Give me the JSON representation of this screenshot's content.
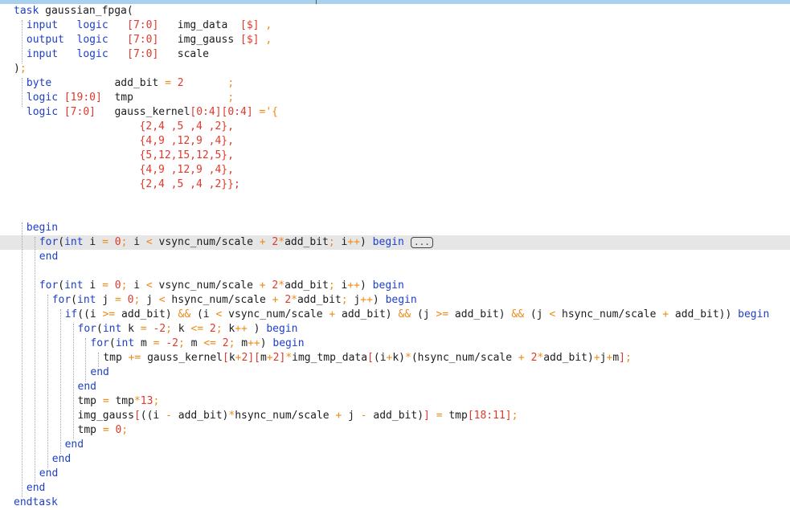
{
  "editor": {
    "fold_marker": "...",
    "lines": [
      {
        "i": 0,
        "segs": [
          [
            "kw",
            "task"
          ],
          [
            "p",
            " gaussian_fpga("
          ]
        ]
      },
      {
        "i": 2,
        "segs": [
          [
            "kw",
            "input"
          ],
          [
            "p",
            "   "
          ],
          [
            "kw",
            "logic"
          ],
          [
            "p",
            "   "
          ],
          [
            "num",
            "[7:0]"
          ],
          [
            "p",
            "   img_data  "
          ],
          [
            "num",
            "[$]"
          ],
          [
            "p",
            " "
          ],
          [
            "op",
            ","
          ]
        ]
      },
      {
        "i": 2,
        "segs": [
          [
            "kw",
            "output"
          ],
          [
            "p",
            "  "
          ],
          [
            "kw",
            "logic"
          ],
          [
            "p",
            "   "
          ],
          [
            "num",
            "[7:0]"
          ],
          [
            "p",
            "   img_gauss "
          ],
          [
            "num",
            "[$]"
          ],
          [
            "p",
            " "
          ],
          [
            "op",
            ","
          ]
        ]
      },
      {
        "i": 2,
        "segs": [
          [
            "kw",
            "input"
          ],
          [
            "p",
            "   "
          ],
          [
            "kw",
            "logic"
          ],
          [
            "p",
            "   "
          ],
          [
            "num",
            "[7:0]"
          ],
          [
            "p",
            "   scale"
          ]
        ]
      },
      {
        "i": 0,
        "segs": [
          [
            "p",
            ")"
          ],
          [
            "op",
            ";"
          ]
        ]
      },
      {
        "i": 2,
        "segs": [
          [
            "kw",
            "byte"
          ],
          [
            "p",
            "          add_bit "
          ],
          [
            "op",
            "="
          ],
          [
            "p",
            " "
          ],
          [
            "num",
            "2"
          ],
          [
            "p",
            "       "
          ],
          [
            "op",
            ";"
          ]
        ]
      },
      {
        "i": 2,
        "segs": [
          [
            "kw",
            "logic"
          ],
          [
            "p",
            " "
          ],
          [
            "num",
            "[19:0]"
          ],
          [
            "p",
            "  tmp               "
          ],
          [
            "op",
            ";"
          ]
        ]
      },
      {
        "i": 2,
        "segs": [
          [
            "kw",
            "logic"
          ],
          [
            "p",
            " "
          ],
          [
            "num",
            "[7:0]"
          ],
          [
            "p",
            "   gauss_kernel"
          ],
          [
            "num",
            "[0:4][0:4]"
          ],
          [
            "p",
            " "
          ],
          [
            "op",
            "='{"
          ]
        ]
      },
      {
        "i": 0,
        "segs": [
          [
            "p",
            "                    "
          ],
          [
            "num",
            "{2,4 ,5 ,4 ,2},"
          ]
        ]
      },
      {
        "i": 0,
        "segs": [
          [
            "p",
            "                    "
          ],
          [
            "num",
            "{4,9 ,12,9 ,4},"
          ]
        ]
      },
      {
        "i": 0,
        "segs": [
          [
            "p",
            "                    "
          ],
          [
            "num",
            "{5,12,15,12,5},"
          ]
        ]
      },
      {
        "i": 0,
        "segs": [
          [
            "p",
            "                    "
          ],
          [
            "num",
            "{4,9 ,12,9 ,4},"
          ]
        ]
      },
      {
        "i": 0,
        "segs": [
          [
            "p",
            "                    "
          ],
          [
            "num",
            "{2,4 ,5 ,4 ,2}};"
          ]
        ]
      },
      {
        "i": 0,
        "segs": []
      },
      {
        "i": 0,
        "segs": []
      },
      {
        "i": 2,
        "segs": [
          [
            "kw",
            "begin"
          ]
        ]
      },
      {
        "i": 4,
        "hl": true,
        "fold": true,
        "segs": [
          [
            "kw",
            "for"
          ],
          [
            "p",
            "("
          ],
          [
            "kw",
            "int"
          ],
          [
            "p",
            " i "
          ],
          [
            "op",
            "="
          ],
          [
            "p",
            " "
          ],
          [
            "num",
            "0"
          ],
          [
            "op",
            ";"
          ],
          [
            "p",
            " i "
          ],
          [
            "op",
            "<"
          ],
          [
            "p",
            " vsync_num/scale "
          ],
          [
            "op",
            "+"
          ],
          [
            "p",
            " "
          ],
          [
            "num",
            "2"
          ],
          [
            "op",
            "*"
          ],
          [
            "p",
            "add_bit"
          ],
          [
            "op",
            ";"
          ],
          [
            "p",
            " i"
          ],
          [
            "op",
            "++"
          ],
          [
            "p",
            ") "
          ],
          [
            "kw",
            "begin"
          ]
        ]
      },
      {
        "i": 4,
        "segs": [
          [
            "kw",
            "end"
          ]
        ]
      },
      {
        "i": 0,
        "segs": []
      },
      {
        "i": 4,
        "segs": [
          [
            "kw",
            "for"
          ],
          [
            "p",
            "("
          ],
          [
            "kw",
            "int"
          ],
          [
            "p",
            " i "
          ],
          [
            "op",
            "="
          ],
          [
            "p",
            " "
          ],
          [
            "num",
            "0"
          ],
          [
            "op",
            ";"
          ],
          [
            "p",
            " i "
          ],
          [
            "op",
            "<"
          ],
          [
            "p",
            " vsync_num/scale "
          ],
          [
            "op",
            "+"
          ],
          [
            "p",
            " "
          ],
          [
            "num",
            "2"
          ],
          [
            "op",
            "*"
          ],
          [
            "p",
            "add_bit"
          ],
          [
            "op",
            ";"
          ],
          [
            "p",
            " i"
          ],
          [
            "op",
            "++"
          ],
          [
            "p",
            ") "
          ],
          [
            "kw",
            "begin"
          ]
        ]
      },
      {
        "i": 6,
        "segs": [
          [
            "kw",
            "for"
          ],
          [
            "p",
            "("
          ],
          [
            "kw",
            "int"
          ],
          [
            "p",
            " j "
          ],
          [
            "op",
            "="
          ],
          [
            "p",
            " "
          ],
          [
            "num",
            "0"
          ],
          [
            "op",
            ";"
          ],
          [
            "p",
            " j "
          ],
          [
            "op",
            "<"
          ],
          [
            "p",
            " hsync_num/scale "
          ],
          [
            "op",
            "+"
          ],
          [
            "p",
            " "
          ],
          [
            "num",
            "2"
          ],
          [
            "op",
            "*"
          ],
          [
            "p",
            "add_bit"
          ],
          [
            "op",
            ";"
          ],
          [
            "p",
            " j"
          ],
          [
            "op",
            "++"
          ],
          [
            "p",
            ") "
          ],
          [
            "kw",
            "begin"
          ]
        ]
      },
      {
        "i": 8,
        "segs": [
          [
            "kw",
            "if"
          ],
          [
            "p",
            "((i "
          ],
          [
            "op",
            ">="
          ],
          [
            "p",
            " add_bit) "
          ],
          [
            "op",
            "&&"
          ],
          [
            "p",
            " (i "
          ],
          [
            "op",
            "<"
          ],
          [
            "p",
            " vsync_num/scale "
          ],
          [
            "op",
            "+"
          ],
          [
            "p",
            " add_bit) "
          ],
          [
            "op",
            "&&"
          ],
          [
            "p",
            " (j "
          ],
          [
            "op",
            ">="
          ],
          [
            "p",
            " add_bit) "
          ],
          [
            "op",
            "&&"
          ],
          [
            "p",
            " (j "
          ],
          [
            "op",
            "<"
          ],
          [
            "p",
            " hsync_num/scale "
          ],
          [
            "op",
            "+"
          ],
          [
            "p",
            " add_bit)) "
          ],
          [
            "kw",
            "begin"
          ]
        ]
      },
      {
        "i": 10,
        "segs": [
          [
            "kw",
            "for"
          ],
          [
            "p",
            "("
          ],
          [
            "kw",
            "int"
          ],
          [
            "p",
            " k "
          ],
          [
            "op",
            "="
          ],
          [
            "p",
            " "
          ],
          [
            "num",
            "-2"
          ],
          [
            "op",
            ";"
          ],
          [
            "p",
            " k "
          ],
          [
            "op",
            "<="
          ],
          [
            "p",
            " "
          ],
          [
            "num",
            "2"
          ],
          [
            "op",
            ";"
          ],
          [
            "p",
            " k"
          ],
          [
            "op",
            "++"
          ],
          [
            "p",
            " ) "
          ],
          [
            "kw",
            "begin"
          ]
        ]
      },
      {
        "i": 12,
        "segs": [
          [
            "kw",
            "for"
          ],
          [
            "p",
            "("
          ],
          [
            "kw",
            "int"
          ],
          [
            "p",
            " m "
          ],
          [
            "op",
            "="
          ],
          [
            "p",
            " "
          ],
          [
            "num",
            "-2"
          ],
          [
            "op",
            ";"
          ],
          [
            "p",
            " m "
          ],
          [
            "op",
            "<="
          ],
          [
            "p",
            " "
          ],
          [
            "num",
            "2"
          ],
          [
            "op",
            ";"
          ],
          [
            "p",
            " m"
          ],
          [
            "op",
            "++"
          ],
          [
            "p",
            ") "
          ],
          [
            "kw",
            "begin"
          ]
        ]
      },
      {
        "i": 14,
        "segs": [
          [
            "p",
            "tmp "
          ],
          [
            "op",
            "+="
          ],
          [
            "p",
            " gauss_kernel"
          ],
          [
            "num",
            "["
          ],
          [
            "p",
            "k"
          ],
          [
            "op",
            "+"
          ],
          [
            "num",
            "2]["
          ],
          [
            "p",
            "m"
          ],
          [
            "op",
            "+"
          ],
          [
            "num",
            "2]"
          ],
          [
            "op",
            "*"
          ],
          [
            "p",
            "img_tmp_data"
          ],
          [
            "num",
            "["
          ],
          [
            "p",
            "(i"
          ],
          [
            "op",
            "+"
          ],
          [
            "p",
            "k)"
          ],
          [
            "op",
            "*"
          ],
          [
            "p",
            "(hsync_num/scale "
          ],
          [
            "op",
            "+"
          ],
          [
            "p",
            " "
          ],
          [
            "num",
            "2"
          ],
          [
            "op",
            "*"
          ],
          [
            "p",
            "add_bit)"
          ],
          [
            "op",
            "+"
          ],
          [
            "p",
            "j"
          ],
          [
            "op",
            "+"
          ],
          [
            "p",
            "m"
          ],
          [
            "num",
            "]"
          ],
          [
            "op",
            ";"
          ]
        ]
      },
      {
        "i": 12,
        "segs": [
          [
            "kw",
            "end"
          ]
        ]
      },
      {
        "i": 10,
        "segs": [
          [
            "kw",
            "end"
          ]
        ]
      },
      {
        "i": 10,
        "segs": [
          [
            "p",
            "tmp "
          ],
          [
            "op",
            "="
          ],
          [
            "p",
            " tmp"
          ],
          [
            "op",
            "*"
          ],
          [
            "num",
            "13"
          ],
          [
            "op",
            ";"
          ]
        ]
      },
      {
        "i": 10,
        "segs": [
          [
            "p",
            "img_gauss"
          ],
          [
            "num",
            "["
          ],
          [
            "p",
            "((i "
          ],
          [
            "op",
            "-"
          ],
          [
            "p",
            " add_bit)"
          ],
          [
            "op",
            "*"
          ],
          [
            "p",
            "hsync_num/scale "
          ],
          [
            "op",
            "+"
          ],
          [
            "p",
            " j "
          ],
          [
            "op",
            "-"
          ],
          [
            "p",
            " add_bit)"
          ],
          [
            "num",
            "]"
          ],
          [
            "p",
            " "
          ],
          [
            "op",
            "="
          ],
          [
            "p",
            " tmp"
          ],
          [
            "num",
            "[18:11]"
          ],
          [
            "op",
            ";"
          ]
        ]
      },
      {
        "i": 10,
        "segs": [
          [
            "p",
            "tmp "
          ],
          [
            "op",
            "="
          ],
          [
            "p",
            " "
          ],
          [
            "num",
            "0"
          ],
          [
            "op",
            ";"
          ]
        ]
      },
      {
        "i": 8,
        "segs": [
          [
            "kw",
            "end"
          ]
        ]
      },
      {
        "i": 6,
        "segs": [
          [
            "kw",
            "end"
          ]
        ]
      },
      {
        "i": 4,
        "segs": [
          [
            "kw",
            "end"
          ]
        ]
      },
      {
        "i": 2,
        "segs": [
          [
            "kw",
            "end"
          ]
        ]
      },
      {
        "i": 0,
        "segs": [
          [
            "kw",
            "endtask"
          ]
        ]
      }
    ]
  }
}
